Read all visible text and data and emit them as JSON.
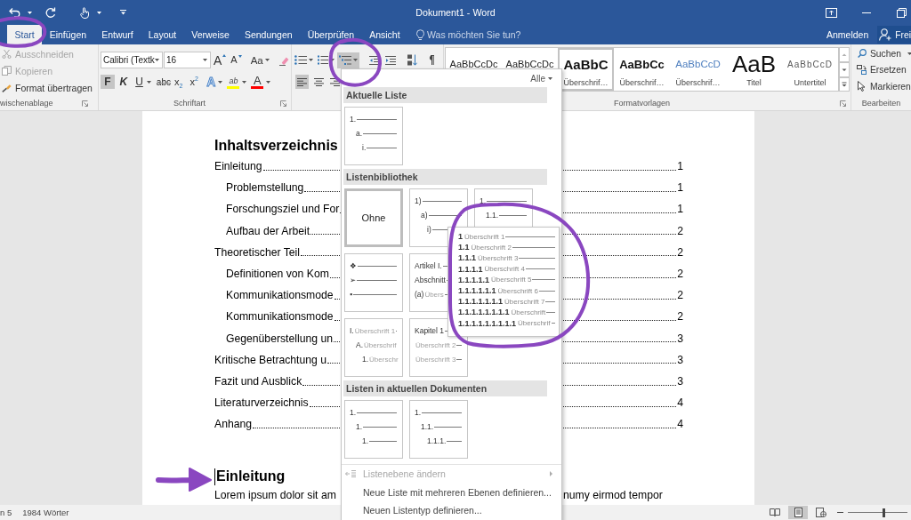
{
  "window": {
    "title": "Dokument1 - Word"
  },
  "tabs": [
    {
      "label": "Start",
      "selected": true
    },
    {
      "label": "Einfügen",
      "selected": false
    },
    {
      "label": "Entwurf",
      "selected": false
    },
    {
      "label": "Layout",
      "selected": false
    },
    {
      "label": "Verweise",
      "selected": false
    },
    {
      "label": "Sendungen",
      "selected": false
    },
    {
      "label": "Überprüfen",
      "selected": false
    },
    {
      "label": "Ansicht",
      "selected": false
    }
  ],
  "tell_me": {
    "placeholder": "Was möchten Sie tun?"
  },
  "account": {
    "sign_in": "Anmelden",
    "share": "Frei"
  },
  "clipboard": {
    "label": "wischenablage",
    "commands": [
      {
        "kind": "cut",
        "label": "Ausschneiden",
        "disabled": true
      },
      {
        "kind": "copy",
        "label": "Kopieren",
        "disabled": true
      },
      {
        "kind": "format_painter",
        "label": "Format übertragen",
        "disabled": false
      }
    ]
  },
  "font": {
    "label": "Schriftart",
    "font_name": "Calibri (Textk",
    "font_size": "16",
    "size_buttons": [
      {
        "kind": "grow",
        "label": "A"
      },
      {
        "kind": "shrink",
        "label": "A"
      }
    ],
    "change_case": "Aa",
    "formats": [
      {
        "kind": "bold",
        "label": "F",
        "selected": true
      },
      {
        "kind": "italic",
        "label": "K",
        "selected": false
      },
      {
        "kind": "underline",
        "label": "U",
        "selected": false
      },
      {
        "kind": "strikethrough",
        "label": "abc",
        "selected": false
      },
      {
        "kind": "subscript",
        "label": "x$_{2}$",
        "selected": false
      },
      {
        "kind": "superscript",
        "label": "x$^{2}$",
        "selected": false
      }
    ],
    "colors": [
      {
        "kind": "effects",
        "label": "A"
      },
      {
        "kind": "highlight",
        "label": "ab",
        "color": "#ffff00"
      },
      {
        "kind": "font_color",
        "label": "A",
        "color": "#ff0000"
      }
    ]
  },
  "paragraph": {
    "list_buttons": [
      {
        "kind": "bullets",
        "selected": false
      },
      {
        "kind": "numbering",
        "selected": false
      },
      {
        "kind": "multilevel",
        "selected": true
      }
    ],
    "alignments": [
      {
        "kind": "left",
        "selected": true
      },
      {
        "kind": "center",
        "selected": false
      },
      {
        "kind": "right",
        "selected": false
      }
    ]
  },
  "styles": {
    "label": "Formatvorlagen",
    "items": [
      {
        "kind": "normal",
        "preview": "AaBbCcDc",
        "selected": false
      },
      {
        "kind": "no_spacing",
        "preview": "AaBbCcDc",
        "selected": false
      },
      {
        "kind": "heading1",
        "preview": "AaBbC",
        "name": "Überschrif…",
        "selected": true
      },
      {
        "kind": "heading2",
        "preview": "AaBbCc",
        "name": "Überschrif…",
        "selected": false
      },
      {
        "kind": "heading3",
        "preview": "AaBbCcD",
        "name": "Überschrif…",
        "selected": false
      },
      {
        "kind": "title",
        "preview": "AaB",
        "name": "Titel",
        "selected": false
      },
      {
        "kind": "subtitle",
        "preview": "AaBbCcD",
        "name": "Untertitel",
        "selected": false
      }
    ]
  },
  "editing": {
    "label": "Bearbeiten",
    "commands": [
      {
        "kind": "find",
        "label": "Suchen"
      },
      {
        "kind": "replace",
        "label": "Ersetzen"
      },
      {
        "kind": "select",
        "label": "Markieren"
      }
    ]
  },
  "document": {
    "toc_title": "Inhaltsverzeichnis",
    "toc": [
      {
        "title": "Einleitung",
        "page": "1",
        "children": [
          {
            "title": "Problemstellung",
            "page": "1"
          },
          {
            "title": "Forschungsziel und For",
            "page": "1"
          },
          {
            "title": "Aufbau der Arbeit",
            "page": "2"
          }
        ]
      },
      {
        "title": "Theoretischer Teil",
        "page": "2",
        "children": [
          {
            "title": "Definitionen von Kom",
            "page": "2"
          },
          {
            "title": "Kommunikationsmode",
            "page": "2"
          },
          {
            "title": "Kommunikationsmode",
            "page": "2"
          },
          {
            "title": "Gegenüberstellung un",
            "page": "3"
          }
        ]
      },
      {
        "title": "Kritische Betrachtung u",
        "page": "3"
      },
      {
        "title": "Fazit und Ausblick",
        "page": "3"
      },
      {
        "title": "Literaturverzeichnis",
        "page": "4"
      },
      {
        "title": "Anhang",
        "page": "4"
      }
    ],
    "heading": "Einleitung",
    "body": [
      "Lorem ipsum dolor sit am",
      "numy eirmod tempor"
    ]
  },
  "list_menu": {
    "filter": "Alle",
    "sections": [
      {
        "title": "Aktuelle Liste",
        "rows": [
          {
            "tiles": [
              {
                "kind": "list",
                "selected": false,
                "lines": [
                  {
                    "marker": "1.",
                    "children": [
                      {
                        "marker": "a.",
                        "children": [
                          {
                            "marker": "i."
                          }
                        ]
                      }
                    ]
                  }
                ]
              }
            ]
          }
        ]
      },
      {
        "title": "Listenbibliothek",
        "rows": [
          {
            "tiles": [
              {
                "kind": "none",
                "label": "Ohne",
                "selected": true
              },
              {
                "kind": "list",
                "selected": false,
                "lines": [
                  {
                    "marker": "1)",
                    "children": [
                      {
                        "marker": "a)",
                        "children": [
                          {
                            "marker": "i)"
                          }
                        ]
                      }
                    ]
                  }
                ]
              },
              {
                "kind": "list",
                "selected": false,
                "lines": [
                  {
                    "marker": "1.",
                    "children": [
                      {
                        "marker": "1.1."
                      }
                    ]
                  }
                ]
              }
            ]
          },
          {
            "tiles": [
              {
                "kind": "list",
                "selected": false,
                "lines": [
                  {
                    "marker": "❖"
                  },
                  {
                    "marker": "➢"
                  },
                  {
                    "marker": "▪"
                  }
                ]
              },
              {
                "kind": "list",
                "selected": false,
                "lines": [
                  {
                    "marker": "Artikel I."
                  },
                  {
                    "marker": "Abschnitt"
                  },
                  {
                    "marker": "(a)",
                    "text": "Übers"
                  }
                ]
              },
              {
                "kind": "preview",
                "lines": [
                  {
                    "marker": "1",
                    "text": "Überschrift 1"
                  },
                  {
                    "marker": "1.1",
                    "text": "Überschrift 2"
                  },
                  {
                    "marker": "1.1.1",
                    "text": "Überschrift 3"
                  },
                  {
                    "marker": "1.1.1.1",
                    "text": "Überschrift 4"
                  },
                  {
                    "marker": "1.1.1.1.1",
                    "text": "Überschrift 5"
                  },
                  {
                    "marker": "1.1.1.1.1.1",
                    "text": "Überschrift 6"
                  },
                  {
                    "marker": "1.1.1.1.1.1.1",
                    "text": "Überschrift 7"
                  },
                  {
                    "marker": "1.1.1.1.1.1.1.1",
                    "text": "Überschrift"
                  },
                  {
                    "marker": "1.1.1.1.1.1.1.1.1",
                    "text": "Überschrif"
                  }
                ]
              }
            ]
          },
          {
            "tiles": [
              {
                "kind": "list",
                "selected": false,
                "lines": [
                  {
                    "marker": "I.",
                    "text": "Überschrift 1",
                    "children": [
                      {
                        "marker": "A.",
                        "text": "Überschrif",
                        "children": [
                          {
                            "marker": "1.",
                            "text": "Überschr"
                          }
                        ]
                      }
                    ]
                  }
                ]
              },
              {
                "kind": "list",
                "selected": false,
                "lines": [
                  {
                    "marker": "Kapitel 1"
                  },
                  {
                    "text": "Überschrift 2"
                  },
                  {
                    "text": "Überschrift 3"
                  }
                ]
              }
            ]
          }
        ]
      },
      {
        "title": "Listen in aktuellen Dokumenten",
        "rows": [
          {
            "tiles": [
              {
                "kind": "list",
                "selected": false,
                "lines": [
                  {
                    "marker": "1.",
                    "children": [
                      {
                        "marker": "1.",
                        "children": [
                          {
                            "marker": "1."
                          }
                        ]
                      }
                    ]
                  }
                ]
              },
              {
                "kind": "list",
                "selected": false,
                "lines": [
                  {
                    "marker": "1.",
                    "children": [
                      {
                        "marker": "1.1.",
                        "children": [
                          {
                            "marker": "1.1.1."
                          }
                        ]
                      }
                    ]
                  }
                ]
              }
            ]
          }
        ]
      }
    ],
    "commands": [
      {
        "label": "Listenebene ändern",
        "disabled": true,
        "submenu": true
      },
      {
        "label": "Neue Liste mit mehreren Ebenen definieren...",
        "disabled": false,
        "submenu": false
      },
      {
        "label": "Neuen Listentyp definieren...",
        "disabled": false,
        "submenu": false
      }
    ]
  },
  "status_bar": {
    "page": "n 5",
    "words": "1984 Wörter",
    "views": [
      {
        "kind": "read",
        "selected": false
      },
      {
        "kind": "print",
        "selected": true
      },
      {
        "kind": "web",
        "selected": false
      }
    ],
    "zoom": {
      "level": 0.6
    }
  }
}
